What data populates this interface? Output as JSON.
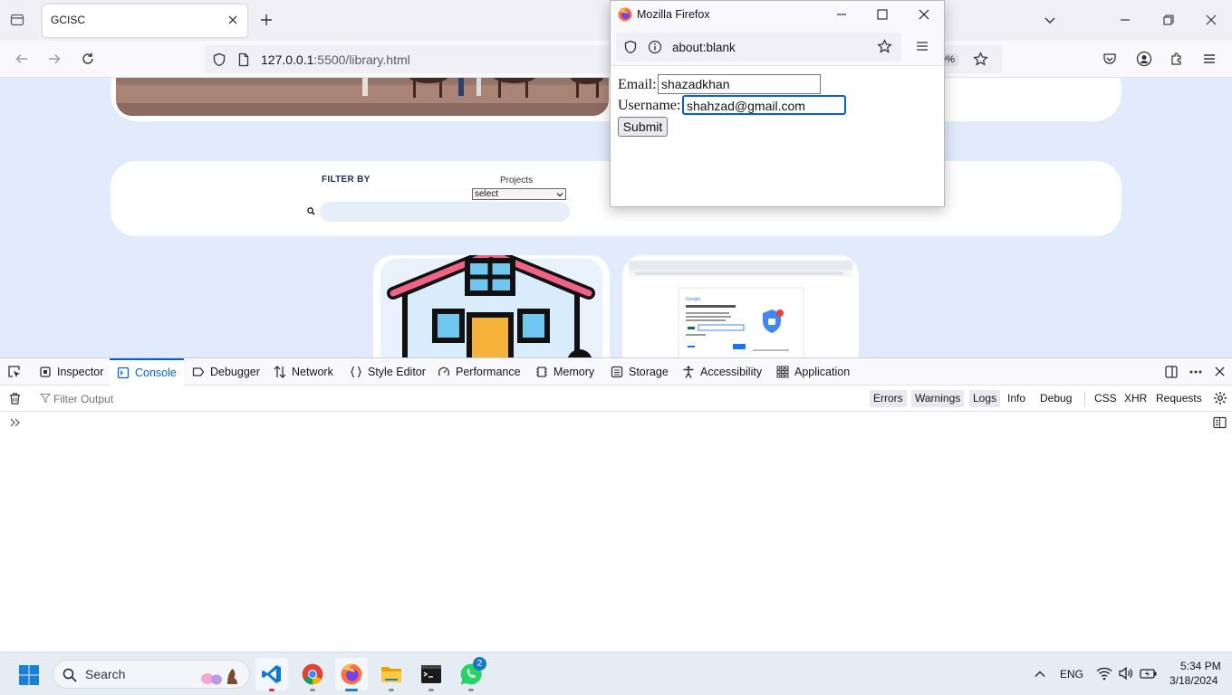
{
  "browser": {
    "tab_title": "GCISC",
    "url_host": "127.0.0.1",
    "url_path": ":5500/library.html",
    "zoom": "0%"
  },
  "page": {
    "filter_by": "FILTER BY",
    "projects_label": "Projects",
    "projects_select": "select",
    "search_placeholder": ""
  },
  "popup": {
    "window_title": "Mozilla Firefox",
    "url": "about:blank",
    "email_label": "Email:",
    "email_value": "shazadkhan",
    "username_label": "Username:",
    "username_value": "shahzad@gmail.com",
    "submit_label": "Submit"
  },
  "devtools": {
    "tabs": [
      "Inspector",
      "Console",
      "Debugger",
      "Network",
      "Style Editor",
      "Performance",
      "Memory",
      "Storage",
      "Accessibility",
      "Application"
    ],
    "active_tab": "Console",
    "filter_placeholder": "Filter Output",
    "levels": [
      "Errors",
      "Warnings",
      "Logs",
      "Info",
      "Debug"
    ],
    "types": [
      "CSS",
      "XHR",
      "Requests"
    ]
  },
  "taskbar": {
    "search_label": "Search",
    "language": "ENG",
    "time": "5:34 PM",
    "date": "3/18/2024",
    "whatsapp_badge": "2"
  },
  "colors": {
    "accent": "#0061e0",
    "page_bg": "#e2ebfb",
    "filter_heading": "#1e2a56"
  }
}
